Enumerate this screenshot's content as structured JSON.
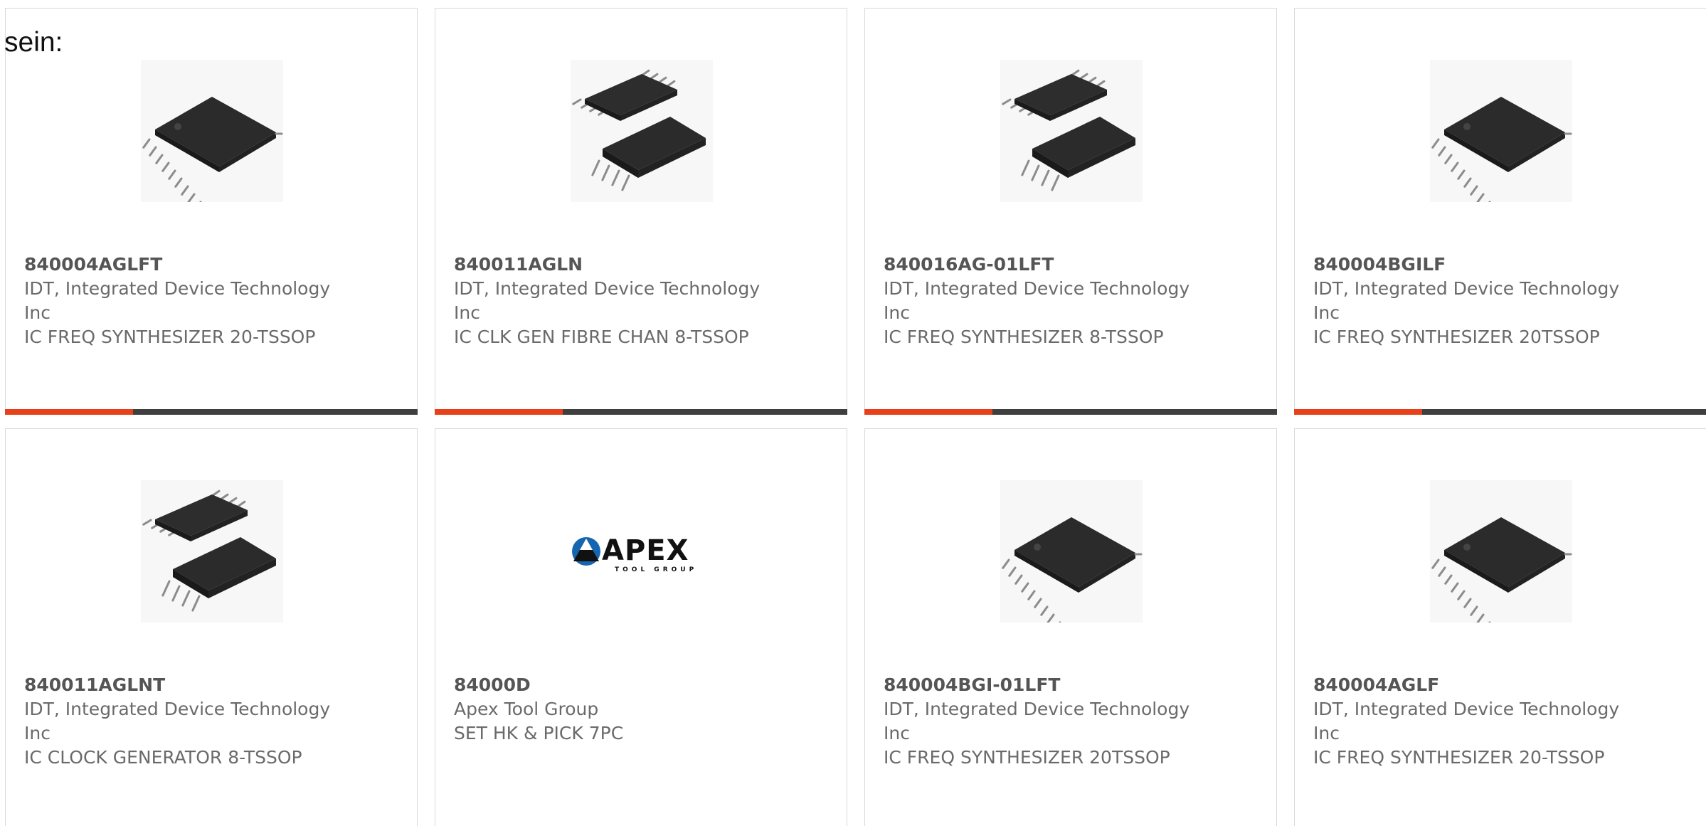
{
  "lead_text": "sein:",
  "colors": {
    "accent_bar": "#e8401b",
    "bar": "#3f3f3f",
    "card_border": "#d9d9d9"
  },
  "products": [
    {
      "part_number": "840004AGLFT",
      "manufacturer": "IDT, Integrated Device Technology Inc",
      "description": "IC FREQ SYNTHESIZER 20-TSSOP",
      "image": "tssop20-chip-icon",
      "bar_accent_fraction": 0.31
    },
    {
      "part_number": "840011AGLN",
      "manufacturer": "IDT, Integrated Device Technology Inc",
      "description": "IC CLK GEN FIBRE CHAN 8-TSSOP",
      "image": "tssop8-chip-pair-icon",
      "bar_accent_fraction": 0.31
    },
    {
      "part_number": "840016AG-01LFT",
      "manufacturer": "IDT, Integrated Device Technology Inc",
      "description": "IC FREQ SYNTHESIZER 8-TSSOP",
      "image": "tssop8-chip-pair-icon",
      "bar_accent_fraction": 0.31
    },
    {
      "part_number": "840004BGILF",
      "manufacturer": "IDT, Integrated Device Technology Inc",
      "description": "IC FREQ SYNTHESIZER 20TSSOP",
      "image": "tssop20-chip-icon",
      "bar_accent_fraction": 0.31
    },
    {
      "part_number": "840011AGLNT",
      "manufacturer": "IDT, Integrated Device Technology Inc",
      "description": "IC CLOCK GENERATOR 8-TSSOP",
      "image": "tssop8-chip-pair-icon",
      "bar_accent_fraction": null
    },
    {
      "part_number": "84000D",
      "manufacturer": "Apex Tool Group",
      "description": "SET HK & PICK 7PC",
      "image": "apex-logo",
      "logo_text": "APEX",
      "logo_subtext": "TOOL GROUP",
      "bar_accent_fraction": null
    },
    {
      "part_number": "840004BGI-01LFT",
      "manufacturer": "IDT, Integrated Device Technology Inc",
      "description": "IC FREQ SYNTHESIZER 20TSSOP",
      "image": "tssop20-chip-icon",
      "bar_accent_fraction": null
    },
    {
      "part_number": "840004AGLF",
      "manufacturer": "IDT, Integrated Device Technology Inc",
      "description": "IC FREQ SYNTHESIZER 20-TSSOP",
      "image": "tssop20-chip-icon",
      "bar_accent_fraction": null
    }
  ]
}
